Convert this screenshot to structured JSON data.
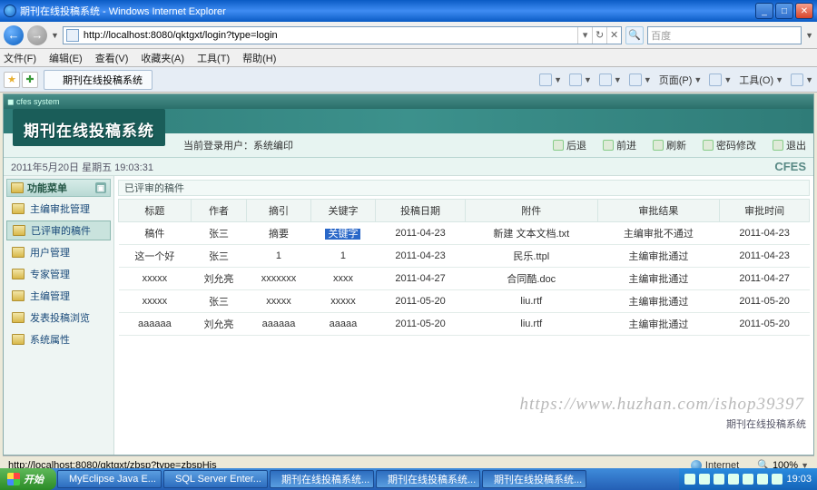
{
  "window": {
    "title": "期刊在线投稿系统 - Windows Internet Explorer"
  },
  "nav": {
    "url": "http://localhost:8080/qktgxt/login?type=login"
  },
  "search": {
    "placeholder": "百度"
  },
  "menu": {
    "file": "文件(F)",
    "edit": "编辑(E)",
    "view": "查看(V)",
    "favorites": "收藏夹(A)",
    "tools": "工具(T)",
    "help": "帮助(H)"
  },
  "tab": {
    "title": "期刊在线投稿系统"
  },
  "pagetools": {
    "home": "",
    "feeds": "",
    "mail": "",
    "print": "",
    "page": "页面(P)",
    "safety": "",
    "tools": "工具(O)"
  },
  "app": {
    "banner": "期刊在线投稿系统",
    "user_label": "当前登录用户：系统编印",
    "date_line": "2011年5月20日 星期五 19:03:31",
    "cfes": "CFES",
    "actions": {
      "back": "后退",
      "forward": "前进",
      "refresh": "刷新",
      "pwd": "密码修改",
      "exit": "退出"
    },
    "sidebar_title": "功能菜单",
    "sidebar": [
      {
        "label": "主编审批管理"
      },
      {
        "label": "已评审的稿件"
      },
      {
        "label": "用户管理"
      },
      {
        "label": "专家管理"
      },
      {
        "label": "主编管理"
      },
      {
        "label": "发表投稿浏览"
      },
      {
        "label": "系统属性"
      }
    ],
    "panel_title": "已评审的稿件",
    "columns": {
      "c0": "标题",
      "c1": "作者",
      "c2": "摘引",
      "c3": "关键字",
      "c4": "投稿日期",
      "c5": "附件",
      "c6": "审批结果",
      "c7": "审批时间"
    },
    "rows": [
      {
        "c0": "稿件",
        "c1": "张三",
        "c2": "摘要",
        "c3": "关键字",
        "c3_hl": true,
        "c4": "2011-04-23",
        "c5": "新建 文本文档.txt",
        "c6": "主编审批不通过",
        "c7": "2011-04-23"
      },
      {
        "c0": "这一个好",
        "c1": "张三",
        "c2": "1",
        "c3": "1",
        "c4": "2011-04-23",
        "c5": "民乐.ttpl",
        "c6": "主编审批通过",
        "c7": "2011-04-23"
      },
      {
        "c0": "xxxxx",
        "c1": "刘允亮",
        "c2": "xxxxxxx",
        "c3": "xxxx",
        "c4": "2011-04-27",
        "c5": "合同酷.doc",
        "c6": "主编审批通过",
        "c7": "2011-04-27"
      },
      {
        "c0": "xxxxx",
        "c1": "张三",
        "c2": "xxxxx",
        "c3": "xxxxx",
        "c4": "2011-05-20",
        "c5": "liu.rtf",
        "c6": "主编审批通过",
        "c7": "2011-05-20"
      },
      {
        "c0": "aaaaaa",
        "c1": "刘允亮",
        "c2": "aaaaaa",
        "c3": "aaaaa",
        "c4": "2011-05-20",
        "c5": "liu.rtf",
        "c6": "主编审批通过",
        "c7": "2011-05-20"
      }
    ],
    "pager_name": "期刊在线投稿系统",
    "watermark": "https://www.huzhan.com/ishop39397"
  },
  "status": {
    "url": "http://localhost:8080/qktgxt/zbsp?type=zbspHis",
    "zone": "Internet",
    "zoom": "100%"
  },
  "taskbar": {
    "start": "开始",
    "items": [
      {
        "label": "MyEclipse Java E..."
      },
      {
        "label": "SQL Server Enter..."
      },
      {
        "label": "期刊在线投稿系统..."
      },
      {
        "label": "期刊在线投稿系统..."
      },
      {
        "label": "期刊在线投稿系统..."
      }
    ],
    "clock": "19:03"
  }
}
